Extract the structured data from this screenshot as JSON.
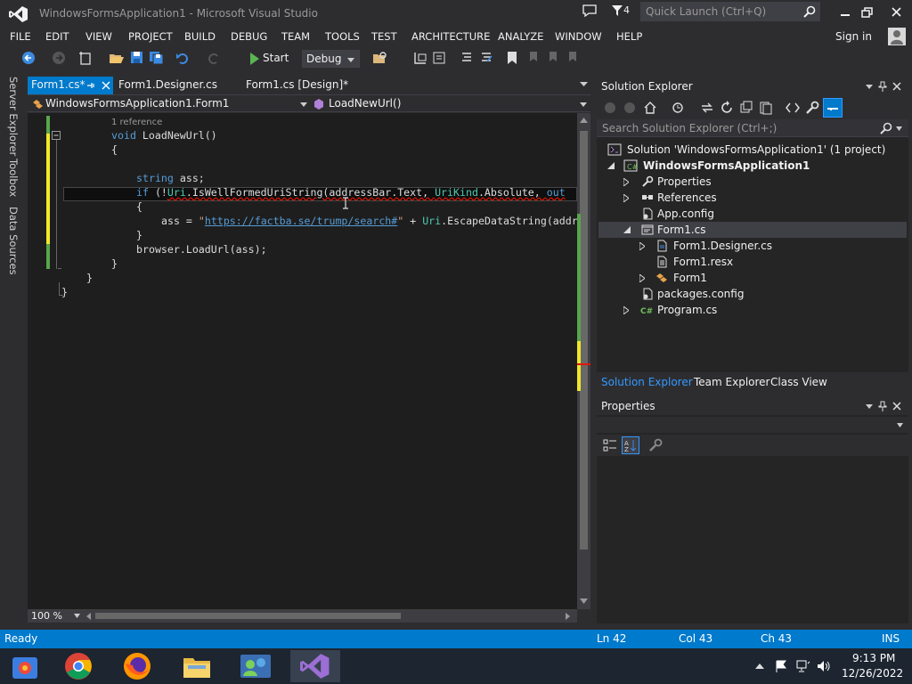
{
  "window": {
    "title": "WindowsFormsApplication1 - Microsoft Visual Studio",
    "notification_count": "4",
    "quick_launch_placeholder": "Quick Launch (Ctrl+Q)"
  },
  "menu": [
    "FILE",
    "EDIT",
    "VIEW",
    "PROJECT",
    "BUILD",
    "DEBUG",
    "TEAM",
    "TOOLS",
    "TEST",
    "ARCHITECTURE",
    "ANALYZE",
    "WINDOW",
    "HELP"
  ],
  "account": {
    "sign_in": "Sign in"
  },
  "toolbar": {
    "start_label": "Start",
    "config": "Debug"
  },
  "left_tabs": [
    "Server Explorer",
    "Toolbox",
    "Data Sources"
  ],
  "editor": {
    "tabs": [
      "Form1.cs*",
      "Form1.Designer.cs",
      "Form1.cs [Design]*"
    ],
    "nav_class": "WindowsFormsApplication1.Form1",
    "nav_member": "LoadNewUrl()",
    "zoom": "100 %",
    "code": {
      "codelens": "1 reference",
      "l1_kw": "void",
      "l1_rest": " LoadNewUrl()",
      "l2": "{",
      "l4_kw": "string",
      "l4_rest": " ass;",
      "l5_if": "if",
      "l5_a": " (!",
      "l5_uri": "Uri",
      "l5_b": ".IsWellFormedUriString(addressBar.Text, ",
      "l5_urikind": "UriKind",
      "l5_c": ".Absolute, ",
      "l5_out": "out",
      "l6": "{",
      "l7_a": "ass = ",
      "l7_q1": "\"",
      "l7_url": "https://factba.se/trump/search#",
      "l7_q2": "\"",
      "l7_b": " + ",
      "l7_uri": "Uri",
      "l7_c": ".EscapeDataString(addr",
      "l8": "}",
      "l9": "browser.LoadUrl(ass);",
      "l10": "}",
      "l11": "}",
      "l12": "}"
    }
  },
  "solution_explorer": {
    "title": "Solution Explorer",
    "search_placeholder": "Search Solution Explorer (Ctrl+;)",
    "items": [
      "Solution 'WindowsFormsApplication1' (1 project)",
      "WindowsFormsApplication1",
      "Properties",
      "References",
      "App.config",
      "Form1.cs",
      "Form1.Designer.cs",
      "Form1.resx",
      "Form1",
      "packages.config",
      "Program.cs"
    ],
    "bottom_tabs": [
      "Solution Explorer",
      "Team Explorer",
      "Class View"
    ]
  },
  "properties": {
    "title": "Properties"
  },
  "status": {
    "text": "Ready",
    "ln": "Ln 42",
    "col": "Col 43",
    "ch": "Ch 43",
    "mode": "INS"
  },
  "clock": {
    "time": "9:13 PM",
    "date": "12/26/2022"
  },
  "colors": {
    "accent": "#007acc",
    "editor_bg": "#1e1e1e",
    "chrome_bg": "#2d2d30"
  }
}
